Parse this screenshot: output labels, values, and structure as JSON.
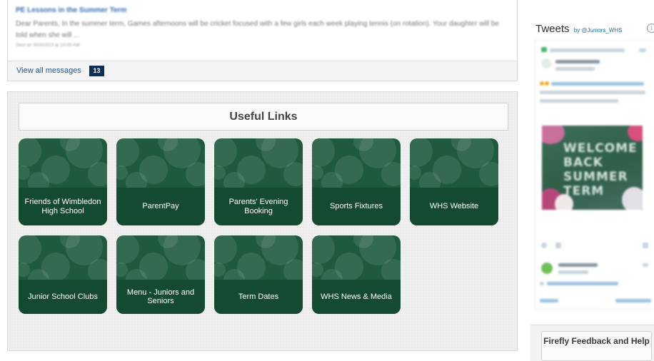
{
  "messages": {
    "title": "PE Lessons in the Summer Term",
    "body": "Dear Parents, In the summer term, Games afternoons will be cricket focused with a few girls each week playing tennis (on rotation). Your daughter will be told when she will ...",
    "sent": "Sent on 30/3/2023 at 10:00 AM",
    "view_all_label": "View all messages",
    "count": "13"
  },
  "useful_links": {
    "heading": "Useful Links",
    "tiles": [
      {
        "label": "Friends of Wimbledon High School"
      },
      {
        "label": "ParentPay"
      },
      {
        "label": "Parents' Evening Booking"
      },
      {
        "label": "Sports Fixtures"
      },
      {
        "label": "WHS Website"
      },
      {
        "label": "Junior School Clubs"
      },
      {
        "label": "Menu - Juniors and Seniors"
      },
      {
        "label": "Term Dates"
      },
      {
        "label": "WHS News & Media"
      }
    ],
    "colors": {
      "tile": "#1f5a3f",
      "tile_band": "#154a32"
    }
  },
  "tweets": {
    "title": "Tweets",
    "by_label": "by @Juniors_WHS",
    "info_glyph": "i",
    "welcome_image_text": "WELCOME BACK SUMMER TERM"
  },
  "feedback": {
    "label": "Firefly Feedback and Help"
  }
}
